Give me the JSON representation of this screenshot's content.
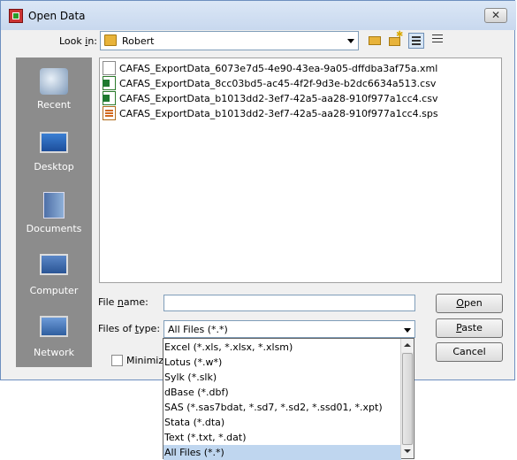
{
  "window": {
    "title": "Open Data",
    "close_symbol": "✕"
  },
  "toolbar": {
    "lookin_label": "Look in:",
    "lookin_value": "Robert"
  },
  "places": [
    {
      "label": "Recent",
      "icon": "recent-icon"
    },
    {
      "label": "Desktop",
      "icon": "desktop-icon"
    },
    {
      "label": "Documents",
      "icon": "documents-icon"
    },
    {
      "label": "Computer",
      "icon": "computer-icon"
    },
    {
      "label": "Network",
      "icon": "network-icon"
    }
  ],
  "files": [
    {
      "name": "CAFAS_ExportData_6073e7d5-4e90-43ea-9a05-dffdba3af75a.xml",
      "icon": "xml-file-icon"
    },
    {
      "name": "CAFAS_ExportData_8cc03bd5-ac45-4f2f-9d3e-b2dc6634a513.csv",
      "icon": "excel-csv-icon"
    },
    {
      "name": "CAFAS_ExportData_b1013dd2-3ef7-42a5-aa28-910f977a1cc4.csv",
      "icon": "excel-csv-icon"
    },
    {
      "name": "CAFAS_ExportData_b1013dd2-3ef7-42a5-aa28-910f977a1cc4.sps",
      "icon": "spss-syntax-icon"
    }
  ],
  "form": {
    "filename_label": "File name:",
    "filename_value": "",
    "filetype_label": "Files of type:",
    "filetype_value": "All Files (*.*)",
    "minimize_label": "Minimize"
  },
  "buttons": {
    "open": "Open",
    "paste": "Paste",
    "cancel": "Cancel"
  },
  "filetype_options": [
    "Excel (*.xls, *.xlsx, *.xlsm)",
    "Lotus (*.w*)",
    "Sylk (*.slk)",
    "dBase (*.dbf)",
    "SAS (*.sas7bdat, *.sd7, *.sd2, *.ssd01, *.xpt)",
    "Stata (*.dta)",
    "Text (*.txt, *.dat)",
    "All Files (*.*)"
  ],
  "selected_option_index": 7
}
